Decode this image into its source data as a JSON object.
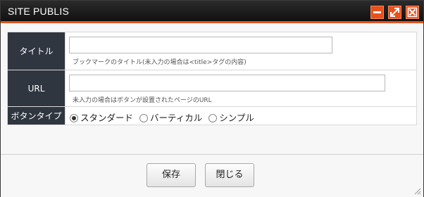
{
  "window": {
    "title": "SITE PUBLIS",
    "controls": [
      "minimize-icon",
      "maximize-icon",
      "close-icon"
    ]
  },
  "form": {
    "title_label": "タイトル",
    "title_value": "",
    "title_hint": "ブックマークのタイトル(未入力の場合は<title>タグの内容)",
    "url_label": "URL",
    "url_value": "",
    "url_hint": "未入力の場合はボタンが設置されたページのURL",
    "button_type_label": "ボタンタイプ",
    "button_type_options": [
      {
        "label": "スタンダード",
        "selected": true
      },
      {
        "label": "バーティカル",
        "selected": false
      },
      {
        "label": "シンプル",
        "selected": false
      }
    ]
  },
  "footer": {
    "save_label": "保存",
    "close_label": "閉じる"
  },
  "colors": {
    "titlebar": "#1a1a1a",
    "accent": "#e8501c",
    "label_bg": "#2f3640"
  }
}
